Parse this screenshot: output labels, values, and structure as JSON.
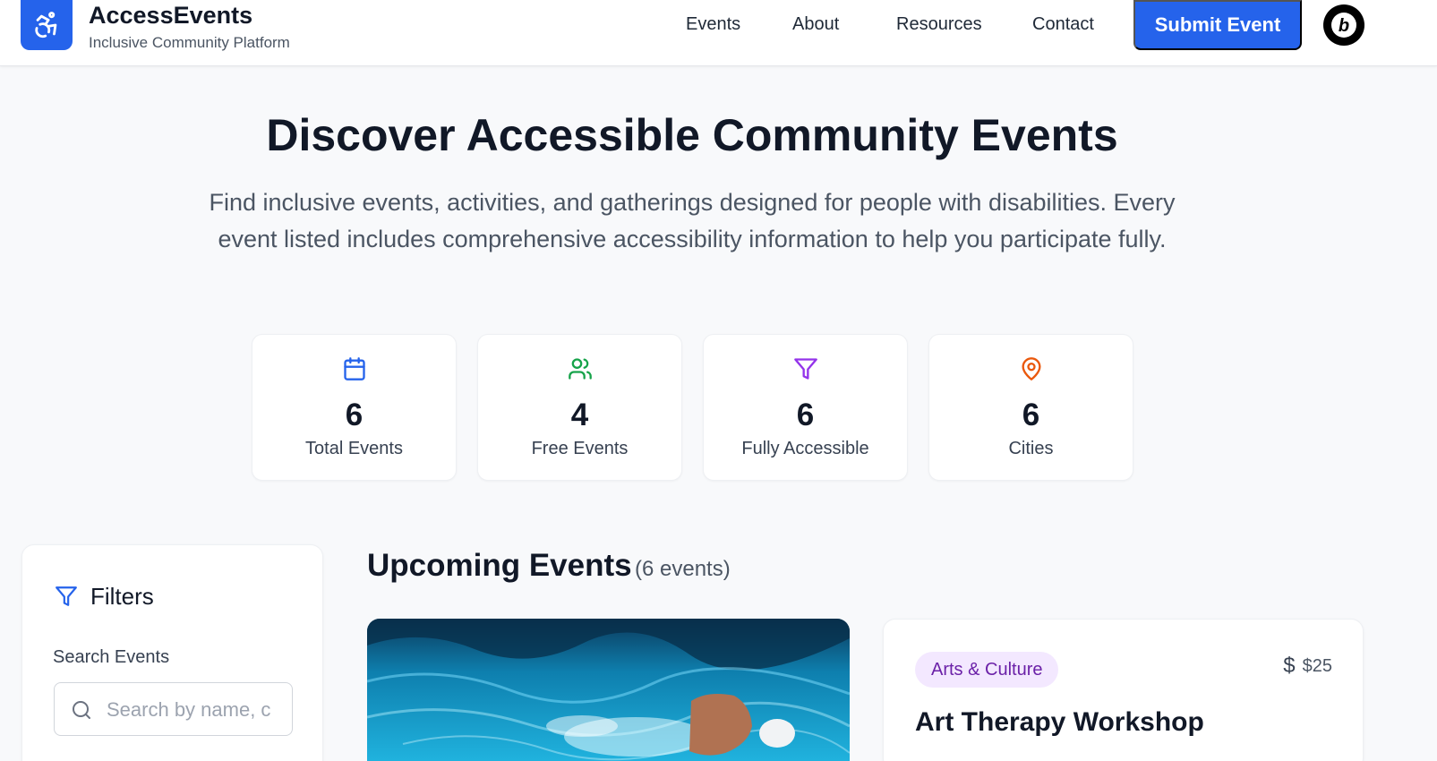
{
  "brand": {
    "title": "AccessEvents",
    "subtitle": "Inclusive Community Platform"
  },
  "nav": {
    "links": [
      "Events",
      "About",
      "Resources",
      "Contact"
    ],
    "submit_label": "Submit Event"
  },
  "hero": {
    "title": "Discover Accessible Community Events",
    "text": "Find inclusive events, activities, and gatherings designed for people with disabilities. Every event listed includes comprehensive accessibility information to help you participate fully."
  },
  "stats": [
    {
      "value": "6",
      "label": "Total Events",
      "icon": "calendar-icon",
      "color": "#2563eb"
    },
    {
      "value": "4",
      "label": "Free Events",
      "icon": "users-icon",
      "color": "#16a34a"
    },
    {
      "value": "6",
      "label": "Fully Accessible",
      "icon": "filter-icon",
      "color": "#9333ea"
    },
    {
      "value": "6",
      "label": "Cities",
      "icon": "map-pin-icon",
      "color": "#ea580c"
    }
  ],
  "filters": {
    "title": "Filters",
    "search_label": "Search Events",
    "search_placeholder": "Search by name, c"
  },
  "events_section": {
    "title": "Upcoming Events",
    "count": "(6 events)"
  },
  "event_card": {
    "category": "Arts & Culture",
    "price": "$25",
    "title": "Art Therapy Workshop"
  },
  "colors": {
    "primary": "#2563eb",
    "category_bg": "#f3e8ff",
    "category_text": "#6b21a8"
  }
}
